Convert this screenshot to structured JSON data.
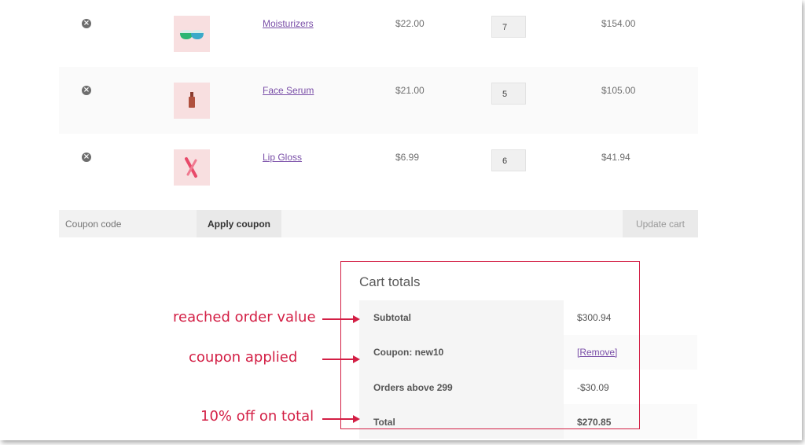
{
  "cart": {
    "items": [
      {
        "name": "Moisturizers",
        "price": "$22.00",
        "qty": "7",
        "total": "$154.00",
        "thumb_icon": "moisturizer-jars-icon"
      },
      {
        "name": "Face Serum",
        "price": "$21.00",
        "qty": "5",
        "total": "$105.00",
        "thumb_icon": "serum-bottle-icon"
      },
      {
        "name": "Lip Gloss",
        "price": "$6.99",
        "qty": "6",
        "total": "$41.94",
        "thumb_icon": "lip-gloss-icon"
      }
    ],
    "remove_icon": "×",
    "coupon_placeholder": "Coupon code",
    "apply_coupon": "Apply coupon",
    "update_cart": "Update cart"
  },
  "totals": {
    "title": "Cart totals",
    "subtotal_label": "Subtotal",
    "subtotal_value": "$300.94",
    "coupon_label": "Coupon: new10",
    "coupon_remove": "[Remove]",
    "discount_label": "Orders above 299",
    "discount_value": "-$30.09",
    "total_label": "Total",
    "total_value": "$270.85"
  },
  "annotations": {
    "order_value": "reached order value",
    "coupon_applied": "coupon applied",
    "ten_percent": "10% off on total",
    "color": "#d31f45"
  }
}
